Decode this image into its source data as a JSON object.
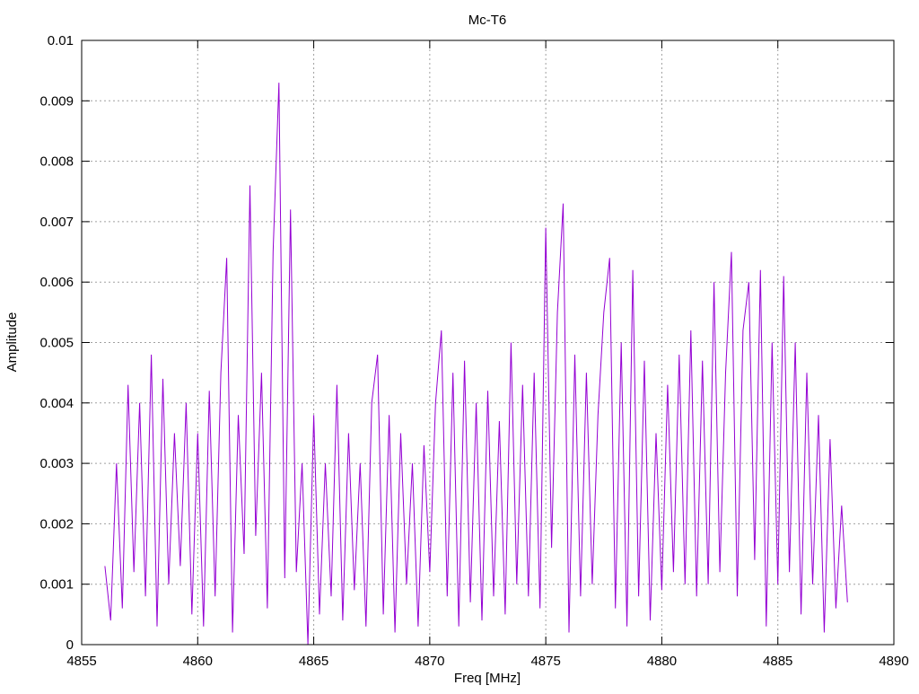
{
  "chart_data": {
    "type": "line",
    "title": "Mc-T6",
    "xlabel": "Freq [MHz]",
    "ylabel": "Amplitude",
    "xlim": [
      4855,
      4890
    ],
    "ylim": [
      0,
      0.01
    ],
    "grid": true,
    "legend": "none",
    "x_ticks": [
      "4855",
      "4860",
      "4865",
      "4870",
      "4875",
      "4880",
      "4885",
      "4890"
    ],
    "x_tick_values": [
      4855,
      4860,
      4865,
      4870,
      4875,
      4880,
      4885,
      4890
    ],
    "y_ticks": [
      "0",
      "0.001",
      "0.002",
      "0.003",
      "0.004",
      "0.005",
      "0.006",
      "0.007",
      "0.008",
      "0.009",
      "0.01"
    ],
    "y_tick_values": [
      0,
      0.001,
      0.002,
      0.003,
      0.004,
      0.005,
      0.006,
      0.007,
      0.008,
      0.009,
      0.01
    ],
    "series": [
      {
        "name": "Mc-T6",
        "color": "#9400d3",
        "x_start": 4856,
        "x_step": 0.25,
        "values": [
          0.0013,
          0.0004,
          0.003,
          0.0006,
          0.0043,
          0.0012,
          0.004,
          0.0008,
          0.0048,
          0.0003,
          0.0044,
          0.001,
          0.0035,
          0.0013,
          0.004,
          0.0005,
          0.0035,
          0.0003,
          0.0042,
          0.0008,
          0.0045,
          0.0064,
          0.0002,
          0.0038,
          0.0015,
          0.0076,
          0.0018,
          0.0045,
          0.0006,
          0.0065,
          0.0093,
          0.0011,
          0.0072,
          0.0012,
          0.003,
          0.0,
          0.0038,
          0.0005,
          0.003,
          0.0008,
          0.0043,
          0.0004,
          0.0035,
          0.0009,
          0.003,
          0.0003,
          0.004,
          0.0048,
          0.0005,
          0.0038,
          0.0002,
          0.0035,
          0.001,
          0.003,
          0.0003,
          0.0033,
          0.0012,
          0.004,
          0.0052,
          0.0008,
          0.0045,
          0.0003,
          0.0047,
          0.0007,
          0.004,
          0.0004,
          0.0042,
          0.0008,
          0.0037,
          0.0005,
          0.005,
          0.001,
          0.0043,
          0.0008,
          0.0045,
          0.0006,
          0.0069,
          0.0016,
          0.0055,
          0.0073,
          0.0002,
          0.0048,
          0.0008,
          0.0045,
          0.001,
          0.0038,
          0.0055,
          0.0064,
          0.0006,
          0.005,
          0.0003,
          0.0062,
          0.0008,
          0.0047,
          0.0004,
          0.0035,
          0.0009,
          0.0043,
          0.0012,
          0.0048,
          0.001,
          0.0052,
          0.0008,
          0.0047,
          0.001,
          0.006,
          0.0012,
          0.0045,
          0.0065,
          0.0008,
          0.0052,
          0.006,
          0.0014,
          0.0062,
          0.0003,
          0.005,
          0.001,
          0.0061,
          0.0012,
          0.005,
          0.0005,
          0.0045,
          0.001,
          0.0038,
          0.0002,
          0.0034,
          0.0006,
          0.0023,
          0.0007
        ]
      }
    ]
  }
}
